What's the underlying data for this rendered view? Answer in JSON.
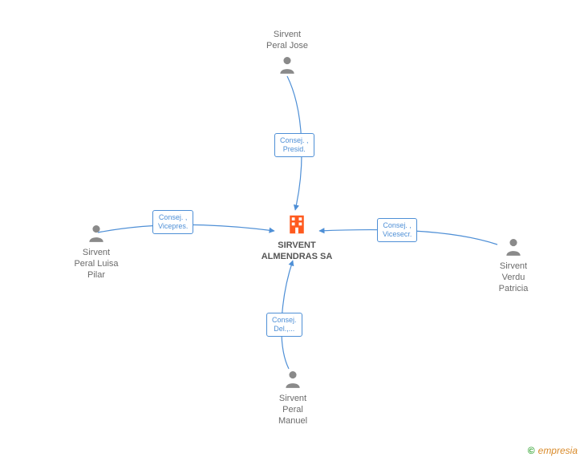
{
  "center": {
    "name": "SIRVENT\nALMENDRAS SA",
    "type": "company"
  },
  "people": {
    "top": {
      "name": "Sirvent\nPeral Jose"
    },
    "left": {
      "name": "Sirvent\nPeral Luisa\nPilar"
    },
    "right": {
      "name": "Sirvent\nVerdu\nPatricia"
    },
    "bottom": {
      "name": "Sirvent\nPeral\nManuel"
    }
  },
  "roles": {
    "top": "Consej. ,\nPresid.",
    "left": "Consej. ,\nVicepres.",
    "right": "Consej. ,\nVicesecr.",
    "bottom": "Consej.\nDel.,..."
  },
  "watermark": {
    "copyright": "©",
    "brand": "empresia"
  },
  "colors": {
    "edge": "#4e8fd6",
    "company": "#ff5a1f",
    "person": "#8a8a8a"
  }
}
